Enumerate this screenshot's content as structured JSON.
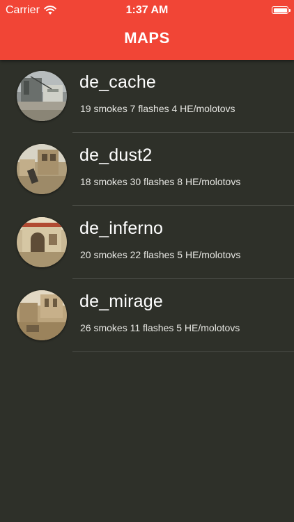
{
  "status_bar": {
    "carrier": "Carrier",
    "time": "1:37 AM",
    "wifi_icon": "wifi-icon",
    "battery_icon": "battery-full-icon"
  },
  "header": {
    "title": "MAPS",
    "background_color": "#f14536"
  },
  "maps": [
    {
      "name": "de_cache",
      "stats": "19 smokes 7 flashes 4 HE/molotovs",
      "thumbnail": "de_cache map preview"
    },
    {
      "name": "de_dust2",
      "stats": "18 smokes 30 flashes 8 HE/molotovs",
      "thumbnail": "de_dust2 map preview"
    },
    {
      "name": "de_inferno",
      "stats": "20 smokes 22 flashes 5 HE/molotovs",
      "thumbnail": "de_inferno map preview"
    },
    {
      "name": "de_mirage",
      "stats": "26 smokes 11 flashes 5 HE/molotovs",
      "thumbnail": "de_mirage map preview"
    }
  ],
  "colors": {
    "list_background": "#2e3029",
    "divider": "#4d4f49"
  }
}
